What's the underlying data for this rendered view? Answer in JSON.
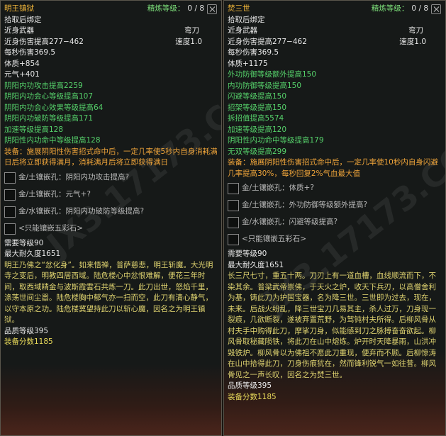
{
  "left": {
    "title": "明王镇狱",
    "refine_label": "精炼等级：",
    "refine_value": "0 / 8",
    "bind": "拾取后绑定",
    "weapon_type": "近身武器",
    "weapon_kind": "弯刀",
    "damage": "近身伤害提高277−462",
    "speed": "速度1.0",
    "dps": "每秒伤害369.5",
    "stats_white": [
      "体质+854",
      "元气+401"
    ],
    "stats_green": [
      "阴阳内功攻击提高2259",
      "阴阳内功会心等级提高107",
      "阴阳内功会心效果等级提高64",
      "阴阳内功破防等级提高171",
      "加速等级提高128",
      "阴阳性内功命中等级提高128"
    ],
    "equip_effect": "装备：施展阴阳性伤害招式命中后，一定几率使5秒内自身消耗满日后将立即获得满月，消耗满月后将立即获得满日",
    "sockets": [
      "金/土镶嵌孔：阴阳内功攻击提高?",
      "金/土镶嵌孔：元气+?",
      "金/水镶嵌孔：阴阳内功破防等级提高?",
      "<只能镶嵌五彩石>"
    ],
    "req_level": "需要等级90",
    "durability": "最大耐久度1651",
    "description": "明王乃佛之“忿化身”。如来悟禅，普萨慈悲，明王斩魔。大光明寺之变后，明教四居西域。陆危楼心中忿恨难解，便花三年时间，取西域精金与波斯霞雲石共炼一刀。此刀出世，怒焰千里，涤荡世间尘嚣。陆危楼胸中郁气亦一扫而空，此刀有清心静气，以守本原之功。陆危楼冀望持此刀以斩心魔，因名之为明王镇狱。",
    "quality": "品质等级395",
    "score": "装备分数1185"
  },
  "right": {
    "title": "焚三世",
    "refine_label": "精炼等级：",
    "refine_value": "0 / 8",
    "bind": "拾取后绑定",
    "weapon_type": "近身武器",
    "weapon_kind": "弯刀",
    "damage": "近身伤害提高277−462",
    "speed": "速度1.0",
    "dps": "每秒伤害369.5",
    "stats_white": [
      "体质+1175"
    ],
    "stats_green": [
      "外功防御等级额外提高150",
      "内功防御等级提高150",
      "闪避等级提高150",
      "招架等级提高150",
      "拆招值提高5574",
      "加速等级提高120",
      "阴阳性内功命中等级提高179",
      "无双等级提高299"
    ],
    "equip_effect": "装备：施展阴阳性伤害招式命中后，一定几率使10秒内自身闪避几率提高30%，每秒回复2%气血最大值",
    "sockets": [
      "金/土镶嵌孔：体质+?",
      "金/土镶嵌孔：外功防御等级额外提高?",
      "金/水镶嵌孔：闪避等级提高?",
      "<只能镶嵌五彩石>"
    ],
    "req_level": "需要等级90",
    "durability": "最大耐久度1651",
    "description": "长三尺七寸，重五十两。刀刃上有一道血槽，血线顺流而下，不染其余。普梁武帝崇佛，于天火之炉，收天下兵刃，以高僧舍利为基，铸此刀为护国宝器，名为降三世。三世即为过去，现在，未来。后战火纷乱，降三世宝刀几易其主，杀人过万，刀身现一裂痕，几欲断裂，遂被弃置荒野，为驾钝村夫所得。后柳风骨从村夫手中购得此刀，摩挲刀身，似能感到刀之脉搏奋奋欲起。柳风骨取秘藏陨铁，将此刀在山中熔炼。炉开时天降暴雨，山洪冲毁铁炉。柳风骨以为佛祖不愿此刀重现，便弃而不顾。后柳惊涛在山中拾得此刀，刀身伤痕犹在，然而锋利锐气一如往昔。柳风骨见之一声长叹，因名之为焚三世。",
    "quality": "品质等级395",
    "score": "装备分数1185"
  },
  "watermark": "JX3.17173.COM"
}
